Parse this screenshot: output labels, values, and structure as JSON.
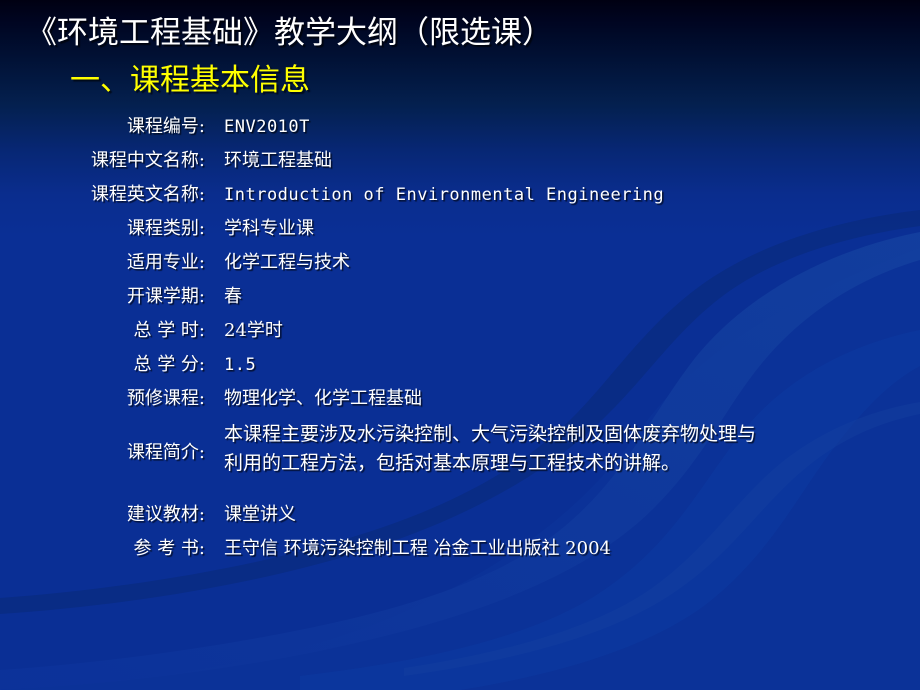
{
  "slide": {
    "title": "《环境工程基础》教学大纲（限选课）",
    "section_title": "一、课程基本信息",
    "colors": {
      "background_top": "#000012",
      "background_main": "#0a2f95",
      "title_color": "#ffffff",
      "section_title_color": "#ffff00"
    }
  },
  "info_rows": [
    {
      "label": "课程编号:",
      "value": "ENV2010T"
    },
    {
      "label": "课程中文名称:",
      "value": "环境工程基础"
    },
    {
      "label": "课程英文名称:",
      "value": "Introduction of Environmental Engineering"
    },
    {
      "label": "课程类别:",
      "value": "学科专业课"
    },
    {
      "label": "适用专业:",
      "value": "化学工程与技术"
    },
    {
      "label": "开课学期:",
      "value": "春"
    },
    {
      "label": "总 学 时:",
      "value": "24学时"
    },
    {
      "label": "总 学 分:",
      "value": "1.5"
    },
    {
      "label": "预修课程:",
      "value": "物理化学、化学工程基础"
    },
    {
      "label": "课程简介:",
      "value_line1": "本课程主要涉及水污染控制、大气污染控制及固体废弃物处理与",
      "value_line2": "利用的工程方法，包括对基本原理与工程技术的讲解。"
    },
    {
      "label": "建议教材:",
      "value": "课堂讲义"
    },
    {
      "label": "参 考 书:",
      "value": "王守信 环境污染控制工程 冶金工业出版社 2004"
    }
  ]
}
